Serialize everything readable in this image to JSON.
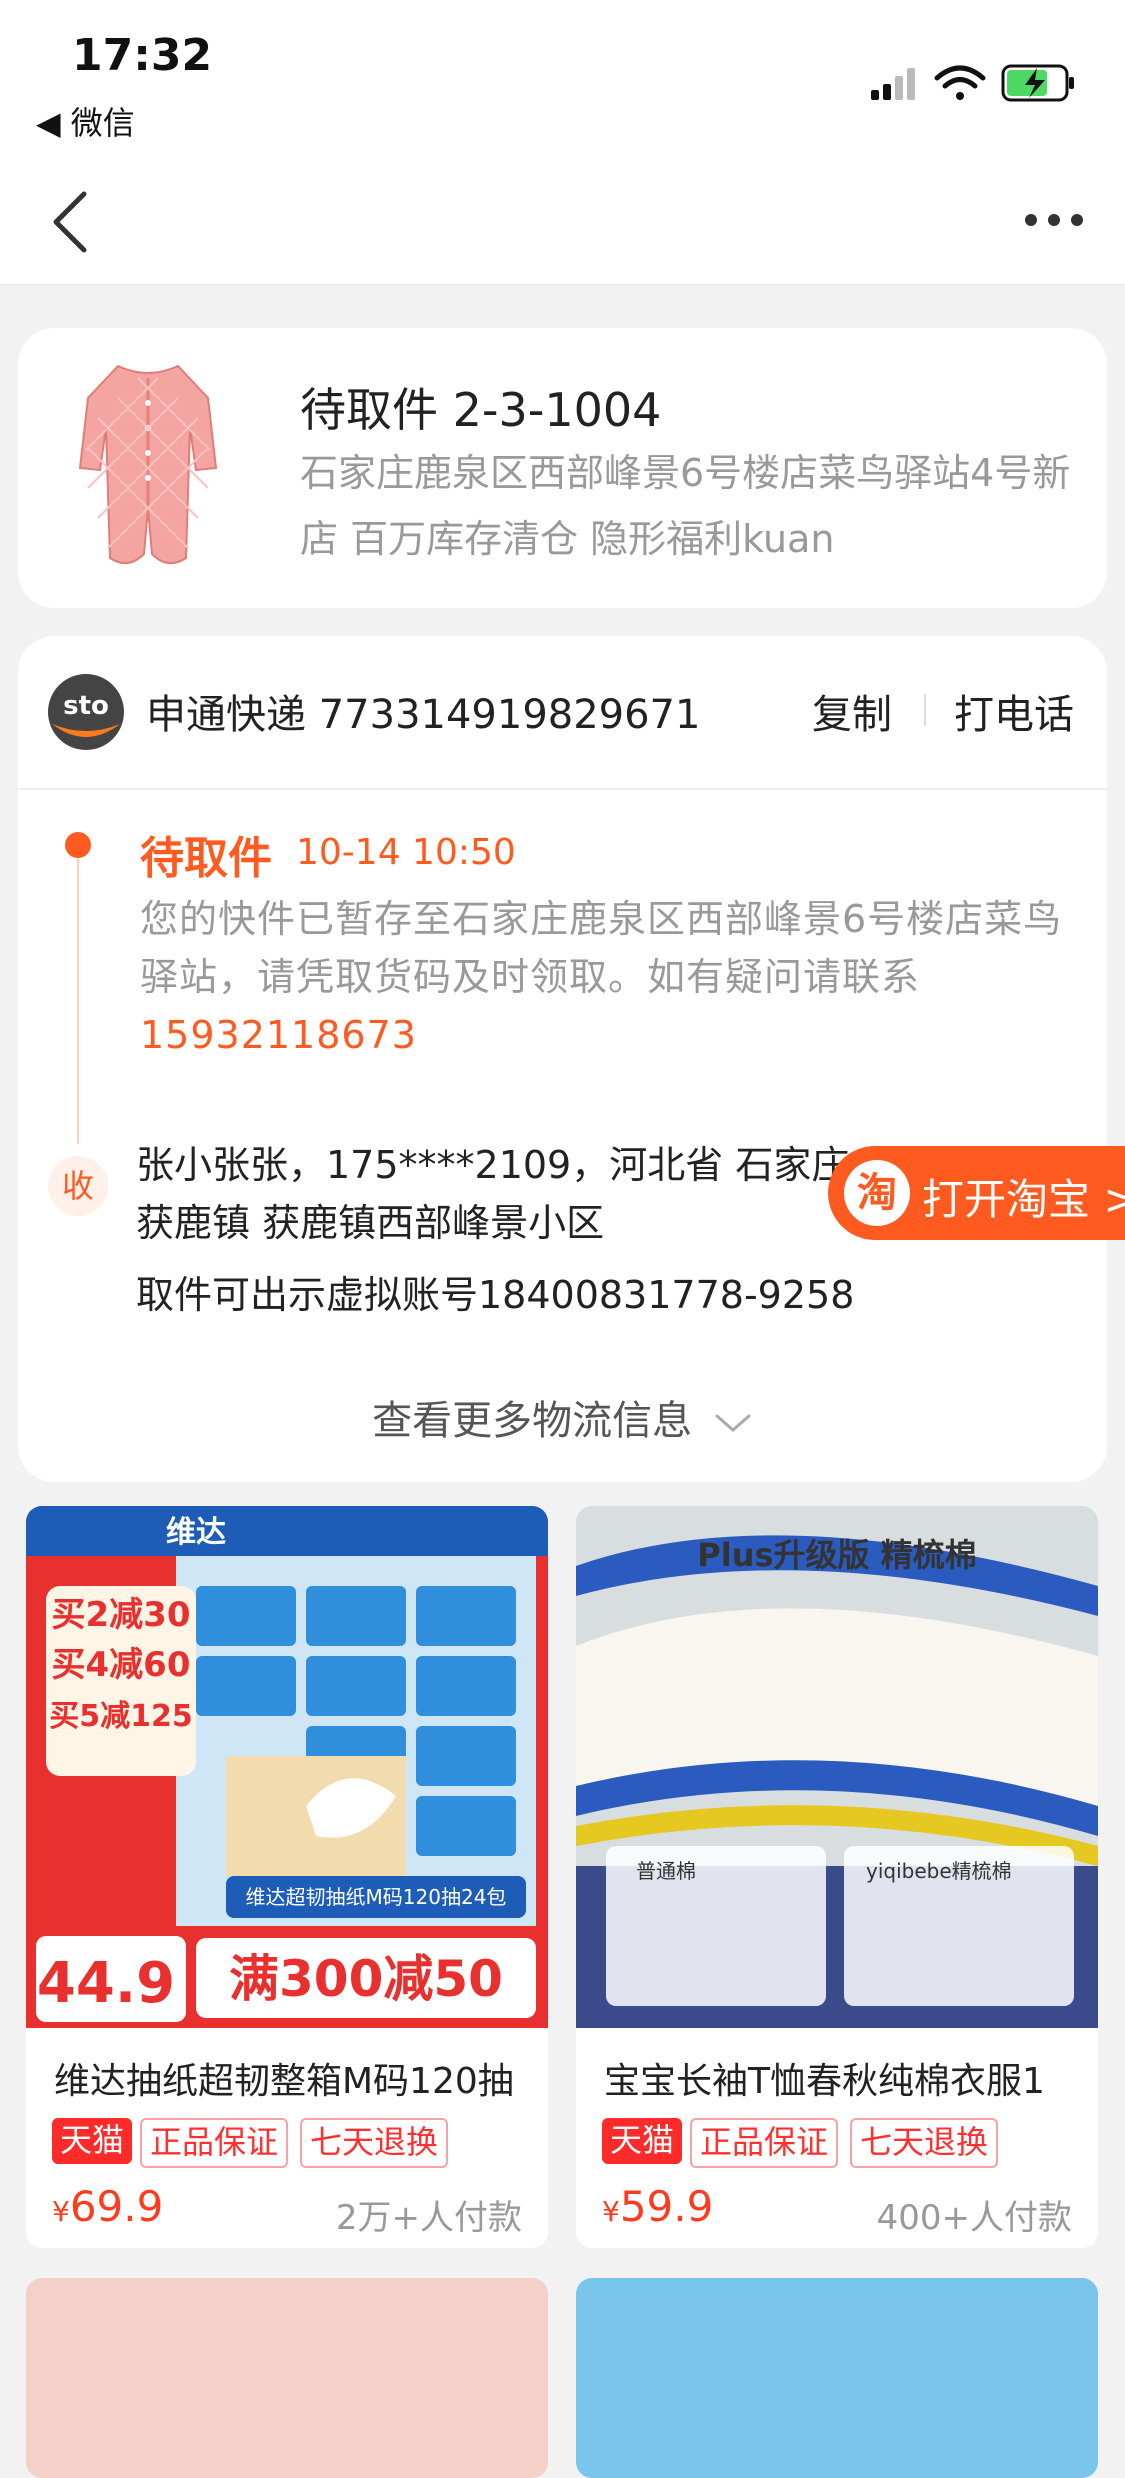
{
  "status_bar": {
    "time": "17:32",
    "back_app": "◀ 微信"
  },
  "package": {
    "title": "待取件 2-3-1004",
    "address": "石家庄鹿泉区西部峰景6号楼店菜鸟驿站4号新店 百万库存清仓 隐形福利kuan"
  },
  "logistics": {
    "carrier_name": "申通快递",
    "tracking_number": "773314919829671",
    "copy_label": "复制",
    "call_label": "打电话",
    "status": "待取件",
    "status_time": "10-14 10:50",
    "description": "您的快件已暂存至石家庄鹿泉区西部峰景6号楼店菜鸟驿站，请凭取货码及时领取。如有疑问请联系",
    "contact_phone": "15932118673",
    "receiver_badge": "收",
    "receiver_line1": "张小张张，175****2109，河北省 石家庄",
    "receiver_line2": "获鹿镇 获鹿镇西部峰景小区",
    "virtual_account": "取件可出示虚拟账号18400831778-9258",
    "more_label": "查看更多物流信息"
  },
  "open_taobao": {
    "icon_char": "淘",
    "label": "打开淘宝 >"
  },
  "products": [
    {
      "title": "维达抽纸超韧整箱M码120抽",
      "tags": [
        "天猫",
        "正品保证",
        "七天退换"
      ],
      "price_symbol": "¥",
      "price": "69.9",
      "paid": "2万+人付款",
      "image_texts": {
        "brand": "维达",
        "promo1": "买2减30",
        "promo2": "买4减60",
        "promo3": "买5减125",
        "unit_price": "44.9",
        "bottom": "满300减50",
        "sub": "维达超韧抽纸M码120抽24包"
      }
    },
    {
      "title": "宝宝长袖T恤春秋纯棉衣服1",
      "tags": [
        "天猫",
        "正品保证",
        "七天退换"
      ],
      "price_symbol": "¥",
      "price": "59.9",
      "paid": "400+人付款",
      "image_texts": {
        "headline": "Plus升级版 精梳棉",
        "left_label": "普通棉",
        "right_label": "yiqibebe精梳棉"
      }
    }
  ],
  "colors": {
    "accent": "#ff5a1f",
    "price": "#ff3a1f",
    "tmall": "#ff2a2a"
  }
}
